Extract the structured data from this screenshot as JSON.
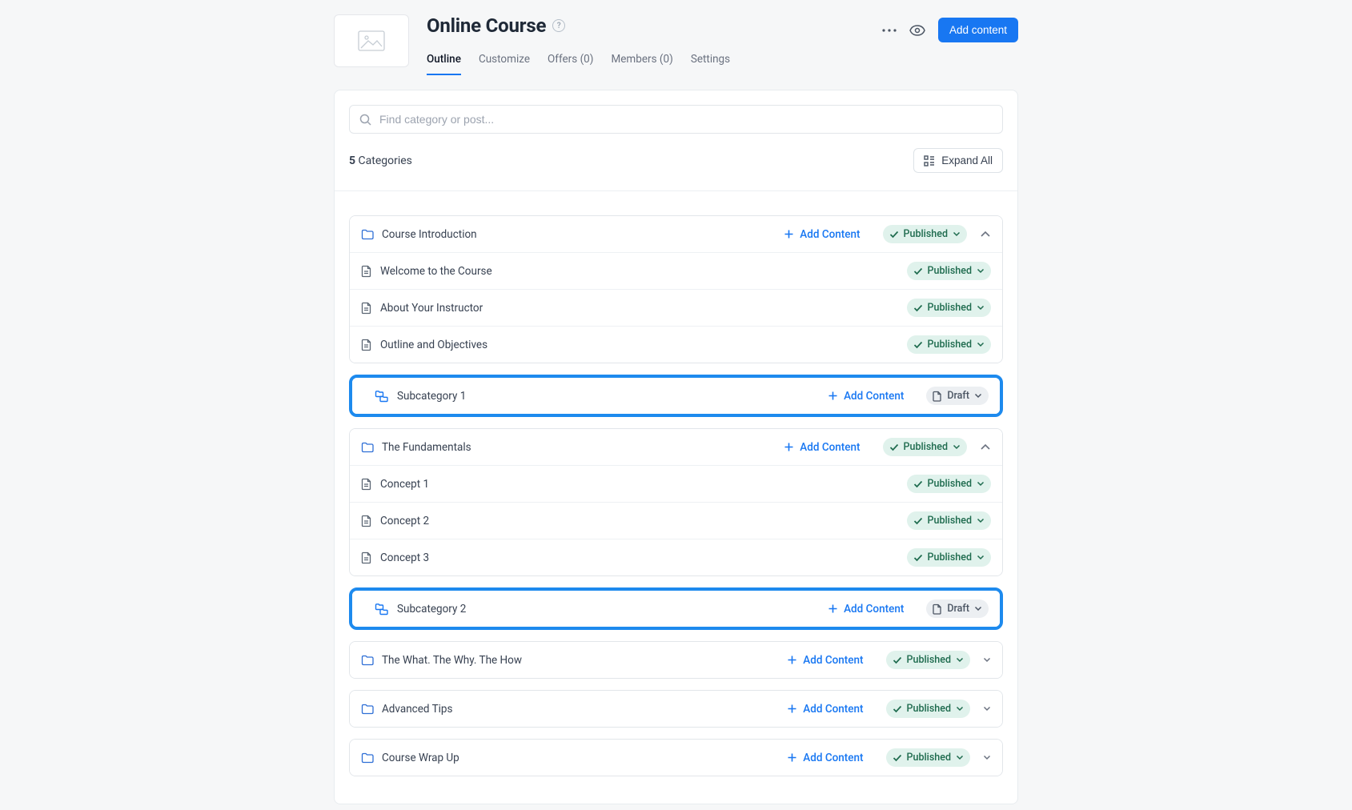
{
  "header": {
    "title": "Online Course",
    "add_content_button": "Add content"
  },
  "tabs": [
    {
      "label": "Outline",
      "active": true
    },
    {
      "label": "Customize",
      "active": false
    },
    {
      "label": "Offers (0)",
      "active": false
    },
    {
      "label": "Members (0)",
      "active": false
    },
    {
      "label": "Settings",
      "active": false
    }
  ],
  "search": {
    "placeholder": "Find category or post..."
  },
  "summary": {
    "count": "5",
    "label": "Categories"
  },
  "expand_all": "Expand All",
  "row_actions": {
    "add_content": "Add Content"
  },
  "status_labels": {
    "published": "Published",
    "draft": "Draft"
  },
  "outline": [
    {
      "type": "category",
      "expanded": true,
      "highlight": false,
      "header": {
        "label": "Course Introduction",
        "status": "published",
        "show_add": true,
        "collapse_icon": true
      },
      "children": [
        {
          "type": "post",
          "label": "Welcome to the Course",
          "status": "published"
        },
        {
          "type": "post",
          "label": "About Your Instructor",
          "status": "published"
        },
        {
          "type": "post",
          "label": "Outline and Objectives",
          "status": "published"
        }
      ]
    },
    {
      "type": "subcategory",
      "highlight": true,
      "header": {
        "label": "Subcategory 1",
        "status": "draft",
        "show_add": true
      }
    },
    {
      "type": "category",
      "expanded": true,
      "highlight": false,
      "header": {
        "label": "The Fundamentals",
        "status": "published",
        "show_add": true,
        "collapse_icon": true
      },
      "children": [
        {
          "type": "post",
          "label": "Concept 1",
          "status": "published"
        },
        {
          "type": "post",
          "label": "Concept 2",
          "status": "published"
        },
        {
          "type": "post",
          "label": "Concept 3",
          "status": "published"
        }
      ]
    },
    {
      "type": "subcategory",
      "highlight": true,
      "header": {
        "label": "Subcategory 2",
        "status": "draft",
        "show_add": true
      }
    },
    {
      "type": "category",
      "expanded": false,
      "highlight": false,
      "header": {
        "label": "The What. The Why. The How",
        "status": "published",
        "show_add": true,
        "collapse_icon": true
      }
    },
    {
      "type": "category",
      "expanded": false,
      "highlight": false,
      "header": {
        "label": "Advanced Tips",
        "status": "published",
        "show_add": true,
        "collapse_icon": true
      }
    },
    {
      "type": "category",
      "expanded": false,
      "highlight": false,
      "header": {
        "label": "Course Wrap Up",
        "status": "published",
        "show_add": true,
        "collapse_icon": true
      }
    }
  ]
}
